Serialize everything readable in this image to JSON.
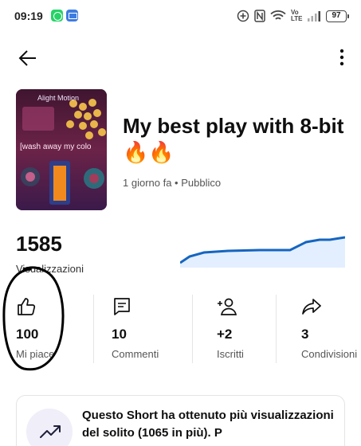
{
  "status_bar": {
    "time": "09:19",
    "battery": "97",
    "network": "Vo LTE"
  },
  "header": {
    "back_icon": "arrow-left-icon",
    "more_icon": "more-vertical-icon"
  },
  "video": {
    "thumbnail_brand": "Alight Motion",
    "thumbnail_caption": "[wash away my colo",
    "title": "My best play with 8-bit🔥🔥",
    "meta": "1 giorno fa • Pubblico"
  },
  "views": {
    "count": "1585",
    "label": "Visualizzazioni"
  },
  "stats": [
    {
      "icon": "thumbs-up-icon",
      "value": "100",
      "label": "Mi piace"
    },
    {
      "icon": "comment-icon",
      "value": "10",
      "label": "Commenti"
    },
    {
      "icon": "add-subscriber-icon",
      "value": "+2",
      "label": "Iscritti"
    },
    {
      "icon": "share-icon",
      "value": "3",
      "label": "Condivisioni"
    }
  ],
  "insight": {
    "icon": "trending-up-icon",
    "text": "Questo Short ha ottenuto più visualizzazioni del solito (1065 in più). P"
  },
  "colors": {
    "accent_blue": "#1565c0",
    "chart_fill": "#e3efff",
    "annotation": "#000000"
  }
}
